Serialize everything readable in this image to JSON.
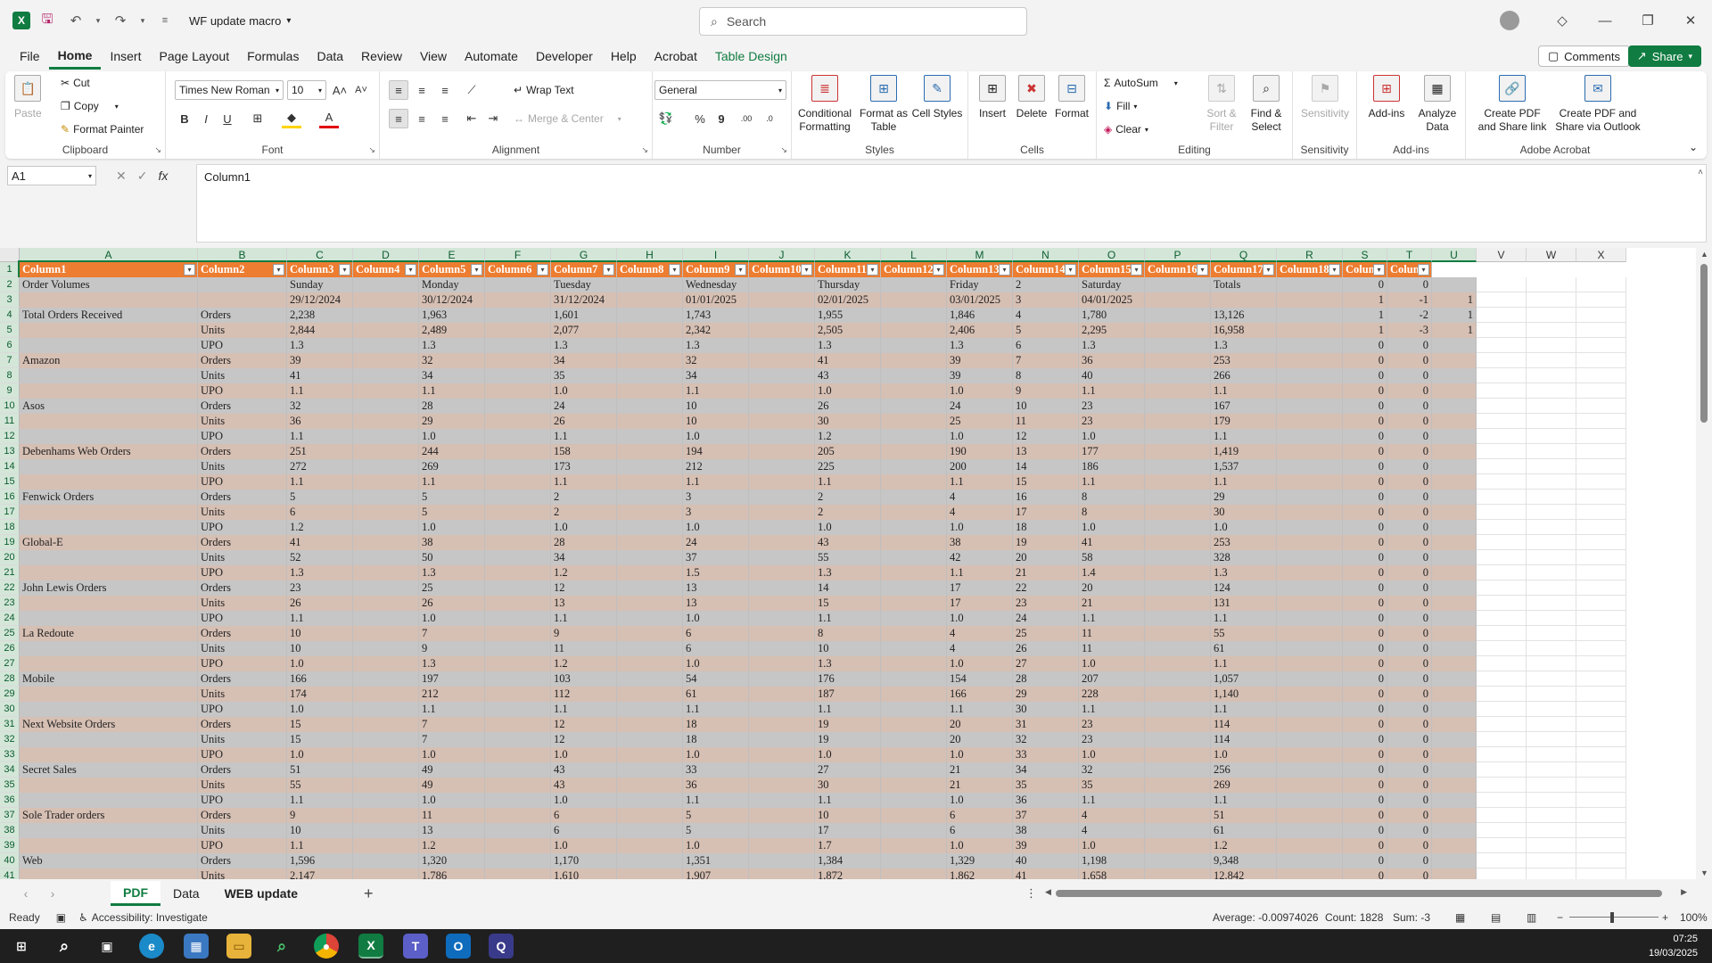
{
  "window": {
    "title": "WF update macro",
    "search_placeholder": "Search"
  },
  "tabs": [
    "File",
    "Home",
    "Insert",
    "Page Layout",
    "Formulas",
    "Data",
    "Review",
    "View",
    "Automate",
    "Developer",
    "Help",
    "Acrobat",
    "Table Design"
  ],
  "actions": {
    "comments": "Comments",
    "share": "Share"
  },
  "ribbon": {
    "clipboard": {
      "label": "Clipboard",
      "paste": "Paste",
      "cut": "Cut",
      "copy": "Copy",
      "format_painter": "Format Painter"
    },
    "font": {
      "label": "Font",
      "family": "Times New Roman",
      "size": "10"
    },
    "alignment": {
      "label": "Alignment",
      "wrap": "Wrap Text",
      "merge": "Merge & Center"
    },
    "number": {
      "label": "Number",
      "format": "General"
    },
    "styles": {
      "label": "Styles",
      "cond": "Conditional Formatting",
      "fmt_table": "Format as Table",
      "cell_styles": "Cell Styles"
    },
    "cells": {
      "label": "Cells",
      "insert": "Insert",
      "delete": "Delete",
      "format": "Format"
    },
    "editing": {
      "label": "Editing",
      "autosum": "AutoSum",
      "fill": "Fill",
      "clear": "Clear",
      "sort": "Sort & Filter",
      "find": "Find & Select"
    },
    "sensitivity": {
      "label": "Sensitivity",
      "btn": "Sensitivity"
    },
    "addins": {
      "label": "Add-ins",
      "btn": "Add-ins",
      "analyze": "Analyze Data"
    },
    "acrobat": {
      "label": "Adobe Acrobat",
      "share_link": "Create PDF and Share link",
      "outlook": "Create PDF and Share via Outlook"
    }
  },
  "formula": {
    "name_box": "A1",
    "content": "Column1"
  },
  "columns": [
    "A",
    "B",
    "C",
    "D",
    "E",
    "F",
    "G",
    "H",
    "I",
    "J",
    "K",
    "L",
    "M",
    "N",
    "O",
    "P",
    "Q",
    "R",
    "S",
    "T",
    "U",
    "V",
    "W",
    "X"
  ],
  "header_row": [
    "Column1",
    "Column2",
    "Column3",
    "Column4",
    "Column5",
    "Column6",
    "Column7",
    "Column8",
    "Column9",
    "Column10",
    "Column11",
    "Column12",
    "Column13",
    "Column14",
    "Column15",
    "Column16",
    "Column17",
    "Column18",
    "Colum",
    "Colum"
  ],
  "rows": [
    {
      "n": "2",
      "a": "Order Volumes",
      "b": "",
      "c": "Sunday",
      "e": "Monday",
      "g": "Tuesday",
      "i": "Wednesday",
      "k": "Thursday",
      "m": "Friday",
      "o": "Saturday",
      "q": "Totals",
      "s": "0",
      "t": "0",
      "u": ""
    },
    {
      "n": "3",
      "a": "",
      "b": "",
      "c": "29/12/2024",
      "e": "30/12/2024",
      "g": "31/12/2024",
      "i": "01/01/2025",
      "k": "02/01/2025",
      "m": "03/01/2025",
      "o": "04/01/2025",
      "q": "",
      "s": "1",
      "t": "-1",
      "u": "1"
    },
    {
      "n": "4",
      "a": "Total Orders Received",
      "b": "Orders",
      "c": "2,238",
      "e": "1,963",
      "g": "1,601",
      "i": "1,743",
      "k": "1,955",
      "m": "1,846",
      "o": "1,780",
      "q": "13,126",
      "s": "1",
      "t": "-2",
      "u": "1"
    },
    {
      "n": "5",
      "a": "",
      "b": "Units",
      "c": "2,844",
      "e": "2,489",
      "g": "2,077",
      "i": "2,342",
      "k": "2,505",
      "m": "2,406",
      "o": "2,295",
      "q": "16,958",
      "s": "1",
      "t": "-3",
      "u": "1"
    },
    {
      "n": "6",
      "a": "",
      "b": "UPO",
      "c": "1.3",
      "e": "1.3",
      "g": "1.3",
      "i": "1.3",
      "k": "1.3",
      "m": "1.3",
      "o": "1.3",
      "q": "1.3",
      "s": "0",
      "t": "0",
      "u": ""
    },
    {
      "n": "7",
      "a": "Amazon",
      "b": "Orders",
      "c": "39",
      "e": "32",
      "g": "34",
      "i": "32",
      "k": "41",
      "m": "39",
      "o": "36",
      "q": "253",
      "s": "0",
      "t": "0",
      "u": ""
    },
    {
      "n": "8",
      "a": "",
      "b": "Units",
      "c": "41",
      "e": "34",
      "g": "35",
      "i": "34",
      "k": "43",
      "m": "39",
      "o": "40",
      "q": "266",
      "s": "0",
      "t": "0",
      "u": ""
    },
    {
      "n": "9",
      "a": "",
      "b": "UPO",
      "c": "1.1",
      "e": "1.1",
      "g": "1.0",
      "i": "1.1",
      "k": "1.0",
      "m": "1.0",
      "o": "1.1",
      "q": "1.1",
      "s": "0",
      "t": "0",
      "u": ""
    },
    {
      "n": "10",
      "a": "Asos",
      "b": "Orders",
      "c": "32",
      "e": "28",
      "g": "24",
      "i": "10",
      "k": "26",
      "m": "24",
      "o": "23",
      "q": "167",
      "s": "0",
      "t": "0",
      "u": ""
    },
    {
      "n": "11",
      "a": "",
      "b": "Units",
      "c": "36",
      "e": "29",
      "g": "26",
      "i": "10",
      "k": "30",
      "m": "25",
      "o": "23",
      "q": "179",
      "s": "0",
      "t": "0",
      "u": ""
    },
    {
      "n": "12",
      "a": "",
      "b": "UPO",
      "c": "1.1",
      "e": "1.0",
      "g": "1.1",
      "i": "1.0",
      "k": "1.2",
      "m": "1.0",
      "o": "1.0",
      "q": "1.1",
      "s": "0",
      "t": "0",
      "u": ""
    },
    {
      "n": "13",
      "a": "Debenhams Web Orders",
      "b": "Orders",
      "c": "251",
      "e": "244",
      "g": "158",
      "i": "194",
      "k": "205",
      "m": "190",
      "o": "177",
      "q": "1,419",
      "s": "0",
      "t": "0",
      "u": ""
    },
    {
      "n": "14",
      "a": "",
      "b": "Units",
      "c": "272",
      "e": "269",
      "g": "173",
      "i": "212",
      "k": "225",
      "m": "200",
      "o": "186",
      "q": "1,537",
      "s": "0",
      "t": "0",
      "u": ""
    },
    {
      "n": "15",
      "a": "",
      "b": "UPO",
      "c": "1.1",
      "e": "1.1",
      "g": "1.1",
      "i": "1.1",
      "k": "1.1",
      "m": "1.1",
      "o": "1.1",
      "q": "1.1",
      "s": "0",
      "t": "0",
      "u": ""
    },
    {
      "n": "16",
      "a": "Fenwick Orders",
      "b": "Orders",
      "c": "5",
      "e": "5",
      "g": "2",
      "i": "3",
      "k": "2",
      "m": "4",
      "o": "8",
      "q": "29",
      "s": "0",
      "t": "0",
      "u": ""
    },
    {
      "n": "17",
      "a": "",
      "b": "Units",
      "c": "6",
      "e": "5",
      "g": "2",
      "i": "3",
      "k": "2",
      "m": "4",
      "o": "8",
      "q": "30",
      "s": "0",
      "t": "0",
      "u": ""
    },
    {
      "n": "18",
      "a": "",
      "b": "UPO",
      "c": "1.2",
      "e": "1.0",
      "g": "1.0",
      "i": "1.0",
      "k": "1.0",
      "m": "1.0",
      "o": "1.0",
      "q": "1.0",
      "s": "0",
      "t": "0",
      "u": ""
    },
    {
      "n": "19",
      "a": "Global-E",
      "b": "Orders",
      "c": "41",
      "e": "38",
      "g": "28",
      "i": "24",
      "k": "43",
      "m": "38",
      "o": "41",
      "q": "253",
      "s": "0",
      "t": "0",
      "u": ""
    },
    {
      "n": "20",
      "a": "",
      "b": "Units",
      "c": "52",
      "e": "50",
      "g": "34",
      "i": "37",
      "k": "55",
      "m": "42",
      "o": "58",
      "q": "328",
      "s": "0",
      "t": "0",
      "u": ""
    },
    {
      "n": "21",
      "a": "",
      "b": "UPO",
      "c": "1.3",
      "e": "1.3",
      "g": "1.2",
      "i": "1.5",
      "k": "1.3",
      "m": "1.1",
      "o": "1.4",
      "q": "1.3",
      "s": "0",
      "t": "0",
      "u": ""
    },
    {
      "n": "22",
      "a": "John Lewis Orders",
      "b": "Orders",
      "c": "23",
      "e": "25",
      "g": "12",
      "i": "13",
      "k": "14",
      "m": "17",
      "o": "20",
      "q": "124",
      "s": "0",
      "t": "0",
      "u": ""
    },
    {
      "n": "23",
      "a": "",
      "b": "Units",
      "c": "26",
      "e": "26",
      "g": "13",
      "i": "13",
      "k": "15",
      "m": "17",
      "o": "21",
      "q": "131",
      "s": "0",
      "t": "0",
      "u": ""
    },
    {
      "n": "24",
      "a": "",
      "b": "UPO",
      "c": "1.1",
      "e": "1.0",
      "g": "1.1",
      "i": "1.0",
      "k": "1.1",
      "m": "1.0",
      "o": "1.1",
      "q": "1.1",
      "s": "0",
      "t": "0",
      "u": ""
    },
    {
      "n": "25",
      "a": "La Redoute",
      "b": "Orders",
      "c": "10",
      "e": "7",
      "g": "9",
      "i": "6",
      "k": "8",
      "m": "4",
      "o": "11",
      "q": "55",
      "s": "0",
      "t": "0",
      "u": ""
    },
    {
      "n": "26",
      "a": "",
      "b": "Units",
      "c": "10",
      "e": "9",
      "g": "11",
      "i": "6",
      "k": "10",
      "m": "4",
      "o": "11",
      "q": "61",
      "s": "0",
      "t": "0",
      "u": ""
    },
    {
      "n": "27",
      "a": "",
      "b": "UPO",
      "c": "1.0",
      "e": "1.3",
      "g": "1.2",
      "i": "1.0",
      "k": "1.3",
      "m": "1.0",
      "o": "1.0",
      "q": "1.1",
      "s": "0",
      "t": "0",
      "u": ""
    },
    {
      "n": "28",
      "a": "Mobile",
      "b": "Orders",
      "c": "166",
      "e": "197",
      "g": "103",
      "i": "54",
      "k": "176",
      "m": "154",
      "o": "207",
      "q": "1,057",
      "s": "0",
      "t": "0",
      "u": ""
    },
    {
      "n": "29",
      "a": "",
      "b": "Units",
      "c": "174",
      "e": "212",
      "g": "112",
      "i": "61",
      "k": "187",
      "m": "166",
      "o": "228",
      "q": "1,140",
      "s": "0",
      "t": "0",
      "u": ""
    },
    {
      "n": "30",
      "a": "",
      "b": "UPO",
      "c": "1.0",
      "e": "1.1",
      "g": "1.1",
      "i": "1.1",
      "k": "1.1",
      "m": "1.1",
      "o": "1.1",
      "q": "1.1",
      "s": "0",
      "t": "0",
      "u": ""
    },
    {
      "n": "31",
      "a": "Next Website Orders",
      "b": "Orders",
      "c": "15",
      "e": "7",
      "g": "12",
      "i": "18",
      "k": "19",
      "m": "20",
      "o": "23",
      "q": "114",
      "s": "0",
      "t": "0",
      "u": ""
    },
    {
      "n": "32",
      "a": "",
      "b": "Units",
      "c": "15",
      "e": "7",
      "g": "12",
      "i": "18",
      "k": "19",
      "m": "20",
      "o": "23",
      "q": "114",
      "s": "0",
      "t": "0",
      "u": ""
    },
    {
      "n": "33",
      "a": "",
      "b": "UPO",
      "c": "1.0",
      "e": "1.0",
      "g": "1.0",
      "i": "1.0",
      "k": "1.0",
      "m": "1.0",
      "o": "1.0",
      "q": "1.0",
      "s": "0",
      "t": "0",
      "u": ""
    },
    {
      "n": "34",
      "a": "Secret Sales",
      "b": "Orders",
      "c": "51",
      "e": "49",
      "g": "43",
      "i": "33",
      "k": "27",
      "m": "21",
      "o": "32",
      "q": "256",
      "s": "0",
      "t": "0",
      "u": ""
    },
    {
      "n": "35",
      "a": "",
      "b": "Units",
      "c": "55",
      "e": "49",
      "g": "43",
      "i": "36",
      "k": "30",
      "m": "21",
      "o": "35",
      "q": "269",
      "s": "0",
      "t": "0",
      "u": ""
    },
    {
      "n": "36",
      "a": "",
      "b": "UPO",
      "c": "1.1",
      "e": "1.0",
      "g": "1.0",
      "i": "1.1",
      "k": "1.1",
      "m": "1.0",
      "o": "1.1",
      "q": "1.1",
      "s": "0",
      "t": "0",
      "u": ""
    },
    {
      "n": "37",
      "a": "Sole Trader orders",
      "b": "Orders",
      "c": "9",
      "e": "11",
      "g": "6",
      "i": "5",
      "k": "10",
      "m": "6",
      "o": "4",
      "q": "51",
      "s": "0",
      "t": "0",
      "u": ""
    },
    {
      "n": "38",
      "a": "",
      "b": "Units",
      "c": "10",
      "e": "13",
      "g": "6",
      "i": "5",
      "k": "17",
      "m": "6",
      "o": "4",
      "q": "61",
      "s": "0",
      "t": "0",
      "u": ""
    },
    {
      "n": "39",
      "a": "",
      "b": "UPO",
      "c": "1.1",
      "e": "1.2",
      "g": "1.0",
      "i": "1.0",
      "k": "1.7",
      "m": "1.0",
      "o": "1.0",
      "q": "1.2",
      "s": "0",
      "t": "0",
      "u": ""
    },
    {
      "n": "40",
      "a": "Web",
      "b": "Orders",
      "c": "1,596",
      "e": "1,320",
      "g": "1,170",
      "i": "1,351",
      "k": "1,384",
      "m": "1,329",
      "o": "1,198",
      "q": "9,348",
      "s": "0",
      "t": "0",
      "u": ""
    },
    {
      "n": "41",
      "a": "",
      "b": "Units",
      "c": "2,147",
      "e": "1,786",
      "g": "1,610",
      "i": "1,907",
      "k": "1,872",
      "m": "1,862",
      "o": "1,658",
      "q": "12,842",
      "s": "0",
      "t": "0",
      "u": ""
    }
  ],
  "sheets": [
    "PDF",
    "Data",
    "WEB update"
  ],
  "status": {
    "ready": "Ready",
    "accessibility": "Accessibility: Investigate",
    "average": "Average: -0.00974026",
    "count": "Count: 1828",
    "sum": "Sum: -3",
    "zoom": "100%"
  },
  "clock": {
    "time": "07:25",
    "date": "19/03/2025"
  },
  "colors": {
    "accent": "#107c41",
    "header": "#ed7d31",
    "band1": "#d6bfb3",
    "band2": "#c6c6c6"
  }
}
